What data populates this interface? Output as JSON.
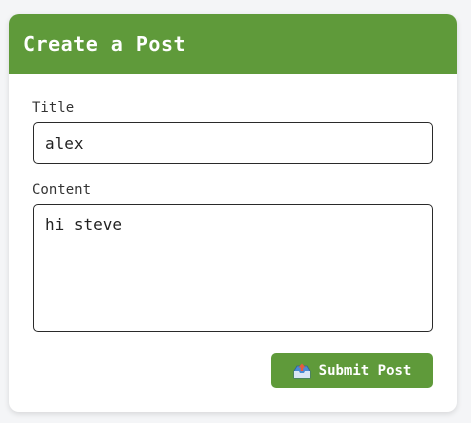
{
  "form": {
    "heading": "Create a Post",
    "title_label": "Title",
    "title_value": "alex",
    "content_label": "Content",
    "content_value": "hi steve",
    "submit_label": "Submit Post",
    "submit_icon": "outbox-tray-icon"
  },
  "colors": {
    "accent": "#5f9a3a",
    "background": "#f4f5f7",
    "card": "#ffffff",
    "border": "#2a2a2a"
  }
}
